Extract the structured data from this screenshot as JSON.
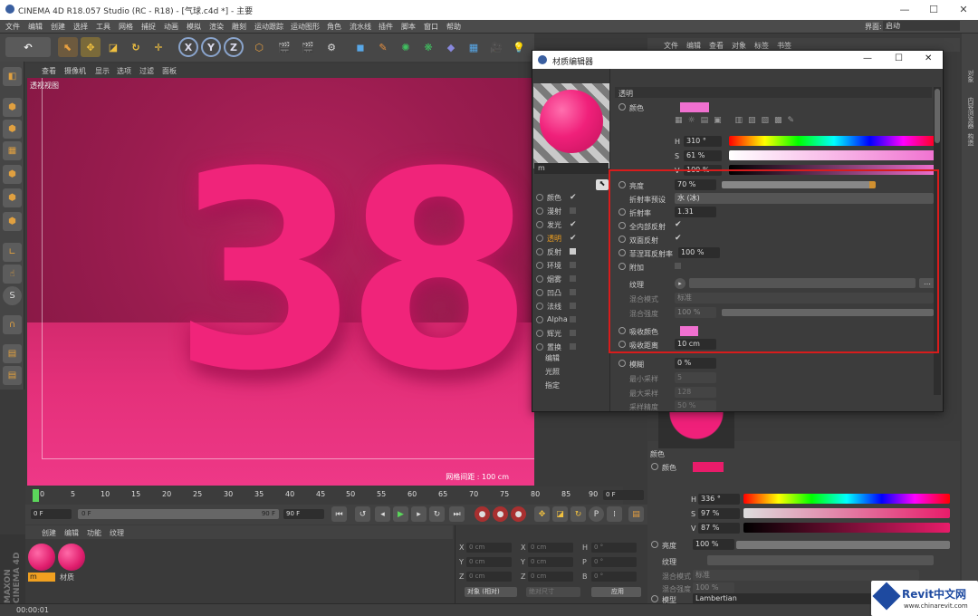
{
  "window": {
    "title": "CINEMA 4D R18.057 Studio (RC - R18) - [气球.c4d *] - 主要"
  },
  "menubar": {
    "items": [
      "文件",
      "编辑",
      "创建",
      "选择",
      "工具",
      "网格",
      "捕捉",
      "动画",
      "模拟",
      "渲染",
      "雕刻",
      "运动跟踪",
      "运动图形",
      "角色",
      "流水线",
      "插件",
      "脚本",
      "窗口",
      "帮助"
    ],
    "layout_label": "界面:",
    "layout_value": "启动"
  },
  "toolbar": {
    "axis": [
      "X",
      "Y",
      "Z"
    ]
  },
  "viewport": {
    "menu": [
      "查看",
      "摄像机",
      "显示",
      "选项",
      "过滤",
      "面板"
    ],
    "label": "透视视图",
    "grid_info": "网格间距 : 100 cm",
    "number": "38"
  },
  "timeline": {
    "ticks": [
      "0",
      "5",
      "10",
      "15",
      "20",
      "25",
      "30",
      "35",
      "40",
      "45",
      "50",
      "55",
      "60",
      "65",
      "70",
      "75",
      "80",
      "85",
      "90"
    ],
    "current": "0 F",
    "start": "0 F",
    "slider_value": "0 F",
    "end_field": "90 F",
    "max_field": "90 F"
  },
  "material_manager": {
    "menu": [
      "创建",
      "编辑",
      "功能",
      "纹理"
    ],
    "materials": [
      {
        "name": "m"
      },
      {
        "name": "材质"
      }
    ]
  },
  "coordinates": {
    "rows": [
      {
        "a": "X",
        "av": "0 cm",
        "b": "X",
        "bv": "0 cm",
        "c": "H",
        "cv": "0 °"
      },
      {
        "a": "Y",
        "av": "0 cm",
        "b": "Y",
        "bv": "0 cm",
        "c": "P",
        "cv": "0 °"
      },
      {
        "a": "Z",
        "av": "0 cm",
        "b": "Z",
        "bv": "0 cm",
        "c": "B",
        "cv": "0 °"
      }
    ],
    "mode": "对象 (相对)",
    "size_mode": "绝对尺寸",
    "apply": "应用"
  },
  "statusbar": {
    "time": "00:00:01"
  },
  "object_manager": {
    "menu": [
      "文件",
      "编辑",
      "查看",
      "对象",
      "标签",
      "书签"
    ]
  },
  "material_editor": {
    "title": "材质编辑器",
    "name": "m",
    "channels": [
      {
        "label": "颜色",
        "checked": true
      },
      {
        "label": "漫射",
        "checked": false
      },
      {
        "label": "发光",
        "checked": true
      },
      {
        "label": "透明",
        "checked": true
      },
      {
        "label": "反射",
        "checked": false
      },
      {
        "label": "环境",
        "checked": false
      },
      {
        "label": "烟雾",
        "checked": false
      },
      {
        "label": "凹凸",
        "checked": false
      },
      {
        "label": "法线",
        "checked": false
      },
      {
        "label": "Alpha",
        "checked": false
      },
      {
        "label": "辉光",
        "checked": false
      },
      {
        "label": "置换",
        "checked": false
      }
    ],
    "extra": [
      "编辑",
      "光照",
      "指定"
    ],
    "section": "透明",
    "color_label": "颜色",
    "hsv": [
      {
        "k": "H",
        "v": "310 °"
      },
      {
        "k": "S",
        "v": "61 %"
      },
      {
        "k": "V",
        "v": "100 %"
      }
    ],
    "brightness": {
      "label": "亮度",
      "value": "70 %"
    },
    "ior_preset": {
      "label": "折射率预设",
      "value": "水 (冰)"
    },
    "ior": {
      "label": "折射率",
      "value": "1.31"
    },
    "total_internal": {
      "label": "全内部反射"
    },
    "double_sided": {
      "label": "双面反射"
    },
    "fresnel": {
      "label": "菲涅耳反射率",
      "value": "100 %"
    },
    "additive": {
      "label": "附加"
    },
    "texture": {
      "label": "纹理"
    },
    "blend_mode": {
      "label": "混合模式",
      "value": "标准"
    },
    "blend_strength": {
      "label": "混合强度",
      "value": "100 %"
    },
    "absorb_color": {
      "label": "吸收颜色"
    },
    "absorb_dist": {
      "label": "吸收距离",
      "value": "10 cm"
    },
    "blur": {
      "label": "模糊",
      "value": "0 %"
    },
    "min_samples": {
      "label": "最小采样",
      "value": "5"
    },
    "max_samples": {
      "label": "最大采样",
      "value": "128"
    },
    "accuracy": {
      "label": "采样精度",
      "value": "50 %"
    },
    "colors": {
      "transparency_color": "#f070d0",
      "absorb": "#f070d0"
    }
  },
  "attributes": {
    "section": "颜色",
    "color_label": "颜色",
    "hsv": [
      {
        "k": "H",
        "v": "336 °"
      },
      {
        "k": "S",
        "v": "97 %"
      },
      {
        "k": "V",
        "v": "87 %"
      }
    ],
    "brightness": {
      "label": "亮度",
      "value": "100 %"
    },
    "texture": "纹理",
    "blend_mode": {
      "label": "混合模式",
      "value": "标准"
    },
    "blend_strength": {
      "label": "混合强度",
      "value": "100 %"
    },
    "model": {
      "label": "模型",
      "value": "Lambertian"
    },
    "swatch": "#e81c6a"
  },
  "watermark": {
    "brand": "Revit中文网",
    "url": "www.chinarevit.com"
  },
  "sidebar_right": {
    "tabs": [
      "对象",
      "内容浏览器",
      "构造"
    ]
  }
}
